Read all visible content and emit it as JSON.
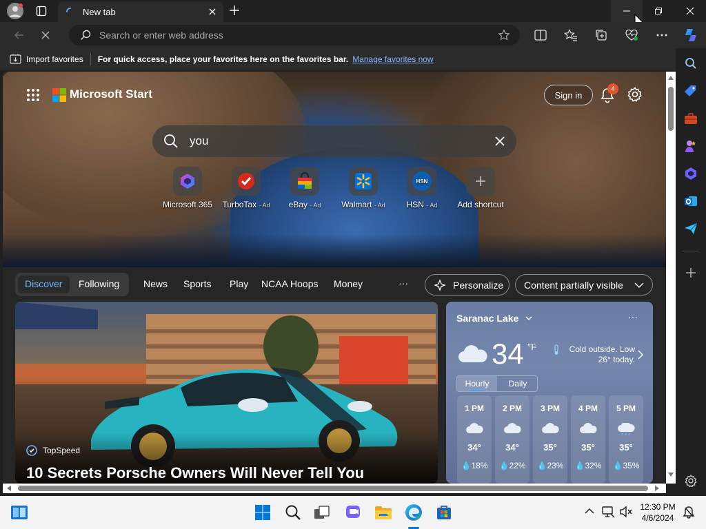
{
  "browser": {
    "tab_title": "New tab",
    "address_placeholder": "Search or enter web address"
  },
  "favorites_bar": {
    "import_label": "Import favorites",
    "hint": "For quick access, place your favorites here on the favorites bar.",
    "manage_link": "Manage favorites now"
  },
  "start": {
    "brand": "Microsoft Start",
    "sign_in": "Sign in",
    "notification_count": "4",
    "search_value": "you",
    "shortcuts": [
      {
        "label": "Microsoft 365",
        "ad": ""
      },
      {
        "label": "TurboTax",
        "ad": "· Ad"
      },
      {
        "label": "eBay",
        "ad": "· Ad"
      },
      {
        "label": "Walmart",
        "ad": "· Ad"
      },
      {
        "label": "HSN",
        "ad": "· Ad"
      },
      {
        "label": "Add shortcut",
        "ad": ""
      }
    ],
    "hsn_logo": "HSN"
  },
  "feed_nav": {
    "discover": "Discover",
    "following": "Following",
    "items": [
      "News",
      "Sports",
      "Play",
      "NCAA Hoops",
      "Money"
    ],
    "more": "···",
    "personalize": "Personalize",
    "content_visibility": "Content partially visible"
  },
  "news": {
    "source": "TopSpeed",
    "headline": "10 Secrets Porsche Owners Will Never Tell You"
  },
  "weather": {
    "location": "Saranac Lake",
    "more": "···",
    "temp": "34",
    "unit": "°F",
    "summary_line1": "Cold outside. Low",
    "summary_line2": "26° today.",
    "tab_hourly": "Hourly",
    "tab_daily": "Daily",
    "hours": [
      {
        "time": "1 PM",
        "temp": "34°",
        "precip": "18%"
      },
      {
        "time": "2 PM",
        "temp": "34°",
        "precip": "22%"
      },
      {
        "time": "3 PM",
        "temp": "35°",
        "precip": "23%"
      },
      {
        "time": "4 PM",
        "temp": "35°",
        "precip": "32%"
      },
      {
        "time": "5 PM",
        "temp": "35°",
        "precip": "35%"
      }
    ]
  },
  "taskbar": {
    "time": "12:30 PM",
    "date": "4/6/2024"
  },
  "colors": {
    "accent": "#0078d4",
    "link": "#8ab4f8",
    "notification_badge": "#e8532e"
  }
}
